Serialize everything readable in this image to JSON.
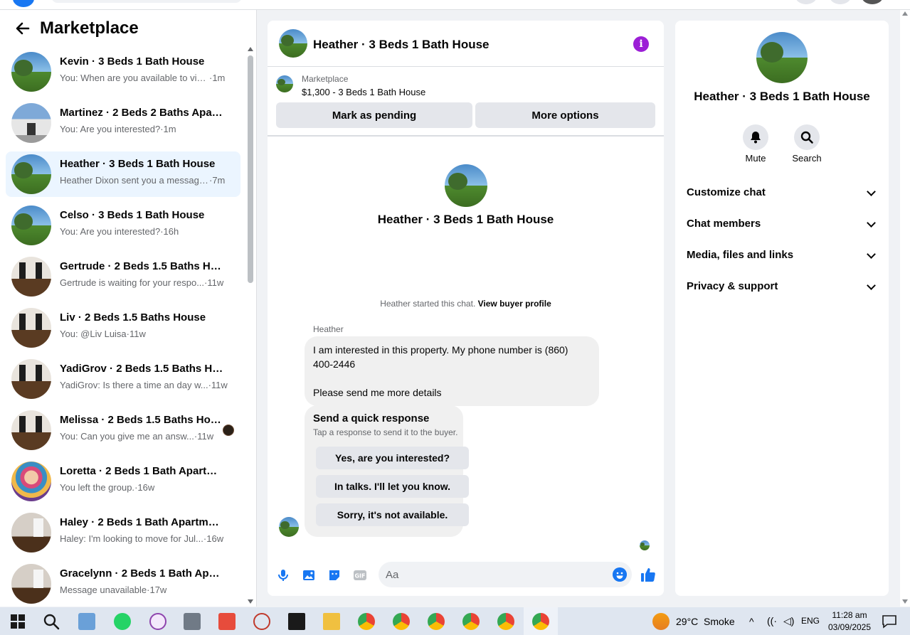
{
  "sidebar": {
    "title": "Marketplace",
    "conversations": [
      {
        "name": "Kevin · 3 Beds 1 Bath House",
        "snippet": "You: When are you available to visi...",
        "time": "·1m",
        "thumb": "house"
      },
      {
        "name": "Martinez · 2 Beds 2 Baths Apart...",
        "snippet": "You: Are you interested?",
        "time": "·1m",
        "thumb": "apt"
      },
      {
        "name": "Heather · 3 Beds 1 Bath House",
        "snippet": "Heather Dixon sent you a message...",
        "time": "·7m",
        "thumb": "house",
        "active": true
      },
      {
        "name": "Celso · 3 Beds 1 Bath House",
        "snippet": "You: Are you interested?",
        "time": "·16h",
        "thumb": "house"
      },
      {
        "name": "Gertrude · 2 Beds 1.5 Baths House",
        "snippet": "Gertrude is waiting for your respo...",
        "time": "·11w",
        "thumb": "room"
      },
      {
        "name": "Liv · 2 Beds 1.5 Baths House",
        "snippet": "You: @Liv Luisa",
        "time": "·11w",
        "thumb": "room"
      },
      {
        "name": "YadiGrov · 2 Beds 1.5 Baths House",
        "snippet": "YadiGrov: Is there a time an day w...",
        "time": "·11w",
        "thumb": "room"
      },
      {
        "name": "Melissa · 2 Beds 1.5 Baths Hou...",
        "snippet": "You: Can you give me an answ...",
        "time": "·11w",
        "thumb": "room",
        "unread": true
      },
      {
        "name": "Loretta · 2 Beds 1 Bath Apartme...",
        "snippet": "You left the group.",
        "time": "·16w",
        "thumb": "art"
      },
      {
        "name": "Haley · 2 Beds 1 Bath Apartment...",
        "snippet": "Haley: I'm looking to move for Jul...",
        "time": "·16w",
        "thumb": "room2"
      },
      {
        "name": "Gracelynn · 2 Beds 1 Bath Apart...",
        "snippet": "Message unavailable",
        "time": "·17w",
        "thumb": "room2"
      }
    ]
  },
  "chat": {
    "title": "Heather · 3 Beds 1 Bath House",
    "listing_label": "Marketplace",
    "listing_price": "$1,300 - 3 Beds 1 Bath House",
    "mark_pending": "Mark as pending",
    "more_options": "More options",
    "profile_title": "Heather · 3 Beds 1 Bath House",
    "started_text": "Heather started this chat.",
    "view_profile": "View buyer profile",
    "sender": "Heather",
    "message_line1": "I am interested in this property. My phone number is (860) 400-2446",
    "message_line2": "Please send me more details",
    "quick_title": "Send a quick response",
    "quick_sub": "Tap a response to send it to the buyer.",
    "quick_replies": [
      "Yes, are you interested?",
      "In talks. I'll let you know.",
      "Sorry, it's not available."
    ],
    "input_placeholder": "Aa"
  },
  "info": {
    "title": "Heather · 3 Beds 1 Bath House",
    "mute": "Mute",
    "search": "Search",
    "sections": [
      "Customize chat",
      "Chat members",
      "Media, files and links",
      "Privacy & support"
    ]
  },
  "taskbar": {
    "weather": "29°C  Smoke",
    "lang": "ENG",
    "time": "11:28 am",
    "date": "03/09/2025"
  },
  "colors": {
    "accent": "#1877f2",
    "info": "#9c1fd6",
    "active_row": "#ebf5ff"
  }
}
